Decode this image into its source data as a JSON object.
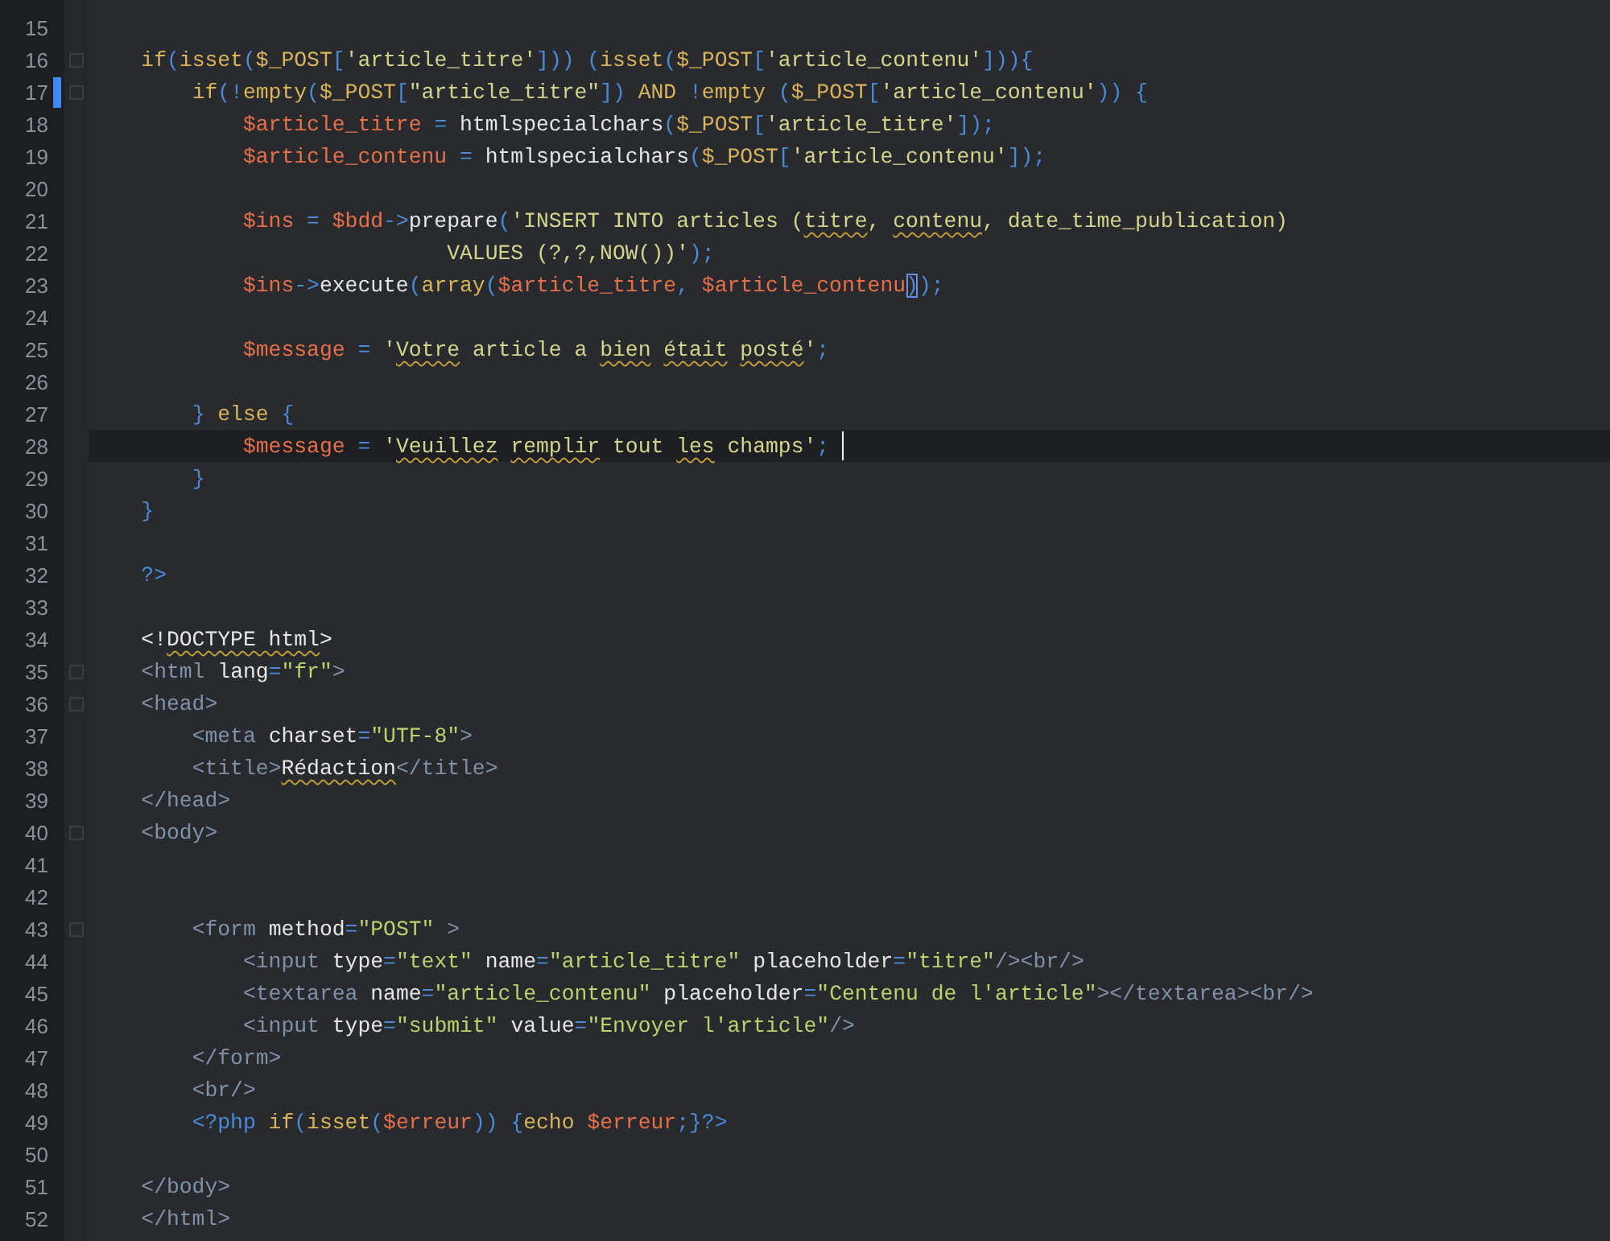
{
  "editor": {
    "lines": [
      {
        "number": "15",
        "foldable": false,
        "modified": false,
        "current": false
      },
      {
        "number": "16",
        "foldable": true,
        "modified": false,
        "current": false,
        "tokens": [
          {
            "kind": "k",
            "text": "    if"
          },
          {
            "kind": "p",
            "text": "("
          },
          {
            "kind": "k",
            "text": "isset"
          },
          {
            "kind": "p",
            "text": "("
          },
          {
            "kind": "k",
            "text": "$_POST"
          },
          {
            "kind": "p",
            "text": "["
          },
          {
            "kind": "s",
            "text": "'article_titre'"
          },
          {
            "kind": "p",
            "text": "])) ("
          },
          {
            "kind": "k",
            "text": "isset"
          },
          {
            "kind": "p",
            "text": "("
          },
          {
            "kind": "k",
            "text": "$_POST"
          },
          {
            "kind": "p",
            "text": "["
          },
          {
            "kind": "s",
            "text": "'article_contenu'"
          },
          {
            "kind": "p",
            "text": "])){"
          }
        ]
      },
      {
        "number": "17",
        "foldable": true,
        "modified": true,
        "current": false,
        "tokens": [
          {
            "kind": "k",
            "text": "        if"
          },
          {
            "kind": "p",
            "text": "(!"
          },
          {
            "kind": "k",
            "text": "empty"
          },
          {
            "kind": "p",
            "text": "("
          },
          {
            "kind": "k",
            "text": "$_POST"
          },
          {
            "kind": "p",
            "text": "["
          },
          {
            "kind": "s",
            "text": "\"article_titre\""
          },
          {
            "kind": "p",
            "text": "]) "
          },
          {
            "kind": "k",
            "text": "AND "
          },
          {
            "kind": "p",
            "text": "!"
          },
          {
            "kind": "k",
            "text": "empty "
          },
          {
            "kind": "p",
            "text": "("
          },
          {
            "kind": "k",
            "text": "$_POST"
          },
          {
            "kind": "p",
            "text": "["
          },
          {
            "kind": "s",
            "text": "'article_contenu'"
          },
          {
            "kind": "p",
            "text": ")) {"
          }
        ]
      },
      {
        "number": "18",
        "foldable": false,
        "modified": false,
        "current": false,
        "tokens": [
          {
            "kind": "v",
            "text": "            $article_titre "
          },
          {
            "kind": "p",
            "text": "="
          },
          {
            "kind": "f",
            "text": " htmlspecialchars"
          },
          {
            "kind": "p",
            "text": "("
          },
          {
            "kind": "k",
            "text": "$_POST"
          },
          {
            "kind": "p",
            "text": "["
          },
          {
            "kind": "s",
            "text": "'article_titre'"
          },
          {
            "kind": "p",
            "text": "]);"
          }
        ]
      },
      {
        "number": "19",
        "foldable": false,
        "modified": false,
        "current": false,
        "tokens": [
          {
            "kind": "v",
            "text": "            $article_contenu "
          },
          {
            "kind": "p",
            "text": "="
          },
          {
            "kind": "f",
            "text": " htmlspecialchars"
          },
          {
            "kind": "p",
            "text": "("
          },
          {
            "kind": "k",
            "text": "$_POST"
          },
          {
            "kind": "p",
            "text": "["
          },
          {
            "kind": "s",
            "text": "'article_contenu'"
          },
          {
            "kind": "p",
            "text": "]);"
          }
        ]
      },
      {
        "number": "20",
        "foldable": false,
        "modified": false,
        "current": false
      },
      {
        "number": "21",
        "foldable": false,
        "modified": false,
        "current": false,
        "tokens": [
          {
            "kind": "v",
            "text": "            $ins "
          },
          {
            "kind": "p",
            "text": "= "
          },
          {
            "kind": "v",
            "text": "$bdd"
          },
          {
            "kind": "p",
            "text": "->"
          },
          {
            "kind": "f",
            "text": "prepare"
          },
          {
            "kind": "p",
            "text": "("
          },
          {
            "kind": "s",
            "text": "'INSERT INTO articles ("
          },
          {
            "kind": "ty",
            "text": "titre"
          },
          {
            "kind": "s",
            "text": ", "
          },
          {
            "kind": "ty",
            "text": "contenu"
          },
          {
            "kind": "s",
            "text": ", date_time_publication)"
          }
        ]
      },
      {
        "number": "22",
        "foldable": false,
        "modified": false,
        "current": false,
        "tokens": [
          {
            "kind": "s",
            "text": "                            VALUES (?,?,NOW())'"
          },
          {
            "kind": "p",
            "text": ");"
          }
        ]
      },
      {
        "number": "23",
        "foldable": false,
        "modified": false,
        "current": false,
        "tokens": [
          {
            "kind": "v",
            "text": "            $ins"
          },
          {
            "kind": "p",
            "text": "->"
          },
          {
            "kind": "f",
            "text": "execute"
          },
          {
            "kind": "p",
            "text": "("
          },
          {
            "kind": "k",
            "text": "array"
          },
          {
            "kind": "p",
            "text": "("
          },
          {
            "kind": "v",
            "text": "$article_titre"
          },
          {
            "kind": "p",
            "text": ", "
          },
          {
            "kind": "v",
            "text": "$article_contenu"
          },
          {
            "kind": "m",
            "text": ")"
          },
          {
            "kind": "p",
            "text": ");"
          }
        ]
      },
      {
        "number": "24",
        "foldable": false,
        "modified": false,
        "current": false
      },
      {
        "number": "25",
        "foldable": false,
        "modified": false,
        "current": false,
        "tokens": [
          {
            "kind": "v",
            "text": "            $message "
          },
          {
            "kind": "p",
            "text": "= "
          },
          {
            "kind": "s",
            "text": "'"
          },
          {
            "kind": "ty",
            "text": "Votre"
          },
          {
            "kind": "s",
            "text": " article a "
          },
          {
            "kind": "ty",
            "text": "bien"
          },
          {
            "kind": "ty",
            "text": " était"
          },
          {
            "kind": "ty",
            "text": " posté"
          },
          {
            "kind": "s",
            "text": "'"
          },
          {
            "kind": "p",
            "text": ";"
          }
        ]
      },
      {
        "number": "26",
        "foldable": false,
        "modified": false,
        "current": false
      },
      {
        "number": "27",
        "foldable": false,
        "modified": false,
        "current": false,
        "tokens": [
          {
            "kind": "p",
            "text": "        } "
          },
          {
            "kind": "k",
            "text": "else "
          },
          {
            "kind": "p",
            "text": "{"
          }
        ]
      },
      {
        "number": "28",
        "foldable": false,
        "modified": false,
        "current": true,
        "tokens": [
          {
            "kind": "v",
            "text": "            $message "
          },
          {
            "kind": "p",
            "text": "= "
          },
          {
            "kind": "s",
            "text": "'"
          },
          {
            "kind": "ty",
            "text": "Veuillez"
          },
          {
            "kind": "ty",
            "text": " remplir"
          },
          {
            "kind": "s",
            "text": " tout "
          },
          {
            "kind": "ty",
            "text": "les"
          },
          {
            "kind": "s",
            "text": " champs'"
          },
          {
            "kind": "p",
            "text": ";"
          }
        ]
      },
      {
        "number": "29",
        "foldable": false,
        "modified": false,
        "current": false,
        "tokens": [
          {
            "kind": "p",
            "text": "        }"
          }
        ]
      },
      {
        "number": "30",
        "foldable": false,
        "modified": false,
        "current": false,
        "tokens": [
          {
            "kind": "p",
            "text": "    }"
          }
        ]
      },
      {
        "number": "31",
        "foldable": false,
        "modified": false,
        "current": false
      },
      {
        "number": "32",
        "foldable": false,
        "modified": false,
        "current": false,
        "tokens": [
          {
            "kind": "p",
            "text": "    ?>"
          }
        ]
      },
      {
        "number": "33",
        "foldable": false,
        "modified": false,
        "current": false
      },
      {
        "number": "34",
        "foldable": false,
        "modified": false,
        "current": false,
        "tokens": [
          {
            "kind": "f",
            "text": "    <!"
          },
          {
            "kind": "tw",
            "text": "DOCTYPE html"
          },
          {
            "kind": "f",
            "text": ">"
          }
        ]
      },
      {
        "number": "35",
        "foldable": true,
        "modified": false,
        "current": false,
        "tokens": [
          {
            "kind": "t",
            "text": "    <html"
          },
          {
            "kind": "a",
            "text": " lang"
          },
          {
            "kind": "p",
            "text": "="
          },
          {
            "kind": "q",
            "text": "\"fr\""
          },
          {
            "kind": "t",
            "text": ">"
          }
        ]
      },
      {
        "number": "36",
        "foldable": true,
        "modified": false,
        "current": false,
        "tokens": [
          {
            "kind": "t",
            "text": "    <head>"
          }
        ]
      },
      {
        "number": "37",
        "foldable": false,
        "modified": false,
        "current": false,
        "tokens": [
          {
            "kind": "t",
            "text": "        <meta"
          },
          {
            "kind": "a",
            "text": " charset"
          },
          {
            "kind": "p",
            "text": "="
          },
          {
            "kind": "q",
            "text": "\"UTF-8\""
          },
          {
            "kind": "t",
            "text": ">"
          }
        ]
      },
      {
        "number": "38",
        "foldable": false,
        "modified": false,
        "current": false,
        "tokens": [
          {
            "kind": "t",
            "text": "        <title>"
          },
          {
            "kind": "tw",
            "text": "Rédaction"
          },
          {
            "kind": "t",
            "text": "</title>"
          }
        ]
      },
      {
        "number": "39",
        "foldable": false,
        "modified": false,
        "current": false,
        "tokens": [
          {
            "kind": "t",
            "text": "    </head>"
          }
        ]
      },
      {
        "number": "40",
        "foldable": true,
        "modified": false,
        "current": false,
        "tokens": [
          {
            "kind": "t",
            "text": "    <body>"
          }
        ]
      },
      {
        "number": "41",
        "foldable": false,
        "modified": false,
        "current": false
      },
      {
        "number": "42",
        "foldable": false,
        "modified": false,
        "current": false
      },
      {
        "number": "43",
        "foldable": true,
        "modified": false,
        "current": false,
        "tokens": [
          {
            "kind": "t",
            "text": "        <form"
          },
          {
            "kind": "a",
            "text": " method"
          },
          {
            "kind": "p",
            "text": "="
          },
          {
            "kind": "q",
            "text": "\"POST\""
          },
          {
            "kind": "t",
            "text": " >"
          }
        ]
      },
      {
        "number": "44",
        "foldable": false,
        "modified": false,
        "current": false,
        "tokens": [
          {
            "kind": "t",
            "text": "            <input"
          },
          {
            "kind": "a",
            "text": " type"
          },
          {
            "kind": "p",
            "text": "="
          },
          {
            "kind": "q",
            "text": "\"text\""
          },
          {
            "kind": "a",
            "text": " name"
          },
          {
            "kind": "p",
            "text": "="
          },
          {
            "kind": "q",
            "text": "\"article_titre\""
          },
          {
            "kind": "a",
            "text": " placeholder"
          },
          {
            "kind": "p",
            "text": "="
          },
          {
            "kind": "q",
            "text": "\"titre\""
          },
          {
            "kind": "t",
            "text": "/><br/>"
          }
        ]
      },
      {
        "number": "45",
        "foldable": false,
        "modified": false,
        "current": false,
        "tokens": [
          {
            "kind": "t",
            "text": "            <textarea"
          },
          {
            "kind": "a",
            "text": " name"
          },
          {
            "kind": "p",
            "text": "="
          },
          {
            "kind": "q",
            "text": "\"article_contenu\""
          },
          {
            "kind": "a",
            "text": " placeholder"
          },
          {
            "kind": "p",
            "text": "="
          },
          {
            "kind": "q",
            "text": "\"Centenu de l'article\""
          },
          {
            "kind": "t",
            "text": "></textarea><br/>"
          }
        ]
      },
      {
        "number": "46",
        "foldable": false,
        "modified": false,
        "current": false,
        "tokens": [
          {
            "kind": "t",
            "text": "            <input"
          },
          {
            "kind": "a",
            "text": " type"
          },
          {
            "kind": "p",
            "text": "="
          },
          {
            "kind": "q",
            "text": "\"submit\""
          },
          {
            "kind": "a",
            "text": " value"
          },
          {
            "kind": "p",
            "text": "="
          },
          {
            "kind": "q",
            "text": "\"Envoyer l'article\""
          },
          {
            "kind": "t",
            "text": "/>"
          }
        ]
      },
      {
        "number": "47",
        "foldable": false,
        "modified": false,
        "current": false,
        "tokens": [
          {
            "kind": "t",
            "text": "        </form>"
          }
        ]
      },
      {
        "number": "48",
        "foldable": false,
        "modified": false,
        "current": false,
        "tokens": [
          {
            "kind": "t",
            "text": "        <br/>"
          }
        ]
      },
      {
        "number": "49",
        "foldable": false,
        "modified": false,
        "current": false,
        "tokens": [
          {
            "kind": "p",
            "text": "        <?php "
          },
          {
            "kind": "k",
            "text": "if"
          },
          {
            "kind": "p",
            "text": "("
          },
          {
            "kind": "k",
            "text": "isset"
          },
          {
            "kind": "p",
            "text": "("
          },
          {
            "kind": "v",
            "text": "$erreur"
          },
          {
            "kind": "p",
            "text": ")) {"
          },
          {
            "kind": "k",
            "text": "echo "
          },
          {
            "kind": "v",
            "text": "$erreur"
          },
          {
            "kind": "p",
            "text": ";}?>"
          }
        ]
      },
      {
        "number": "50",
        "foldable": false,
        "modified": false,
        "current": false
      },
      {
        "number": "51",
        "foldable": false,
        "modified": false,
        "current": false,
        "tokens": [
          {
            "kind": "t",
            "text": "    </body>"
          }
        ]
      },
      {
        "number": "52",
        "foldable": false,
        "modified": false,
        "current": false,
        "tokens": [
          {
            "kind": "t",
            "text": "    </html>"
          }
        ]
      }
    ]
  }
}
